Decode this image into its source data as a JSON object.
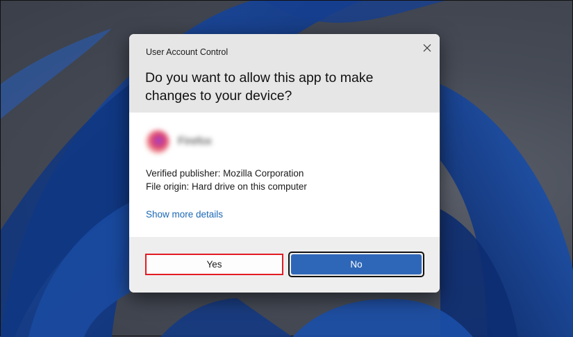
{
  "dialog": {
    "window_title": "User Account Control",
    "question": "Do you want to allow this app to make changes to your device?",
    "app_name": "Firefox",
    "publisher": "Verified publisher: Mozilla Corporation",
    "origin": "File origin: Hard drive on this computer",
    "details_link": "Show more details",
    "yes_label": "Yes",
    "no_label": "No",
    "close_icon": "close-icon",
    "app_icon": "firefox-app-icon"
  },
  "colors": {
    "accent": "#2f67b8",
    "link": "#1b68b4",
    "highlight_border": "#e21b23",
    "header_background": "#e6e6e6",
    "footer_background": "#eeeeee"
  }
}
